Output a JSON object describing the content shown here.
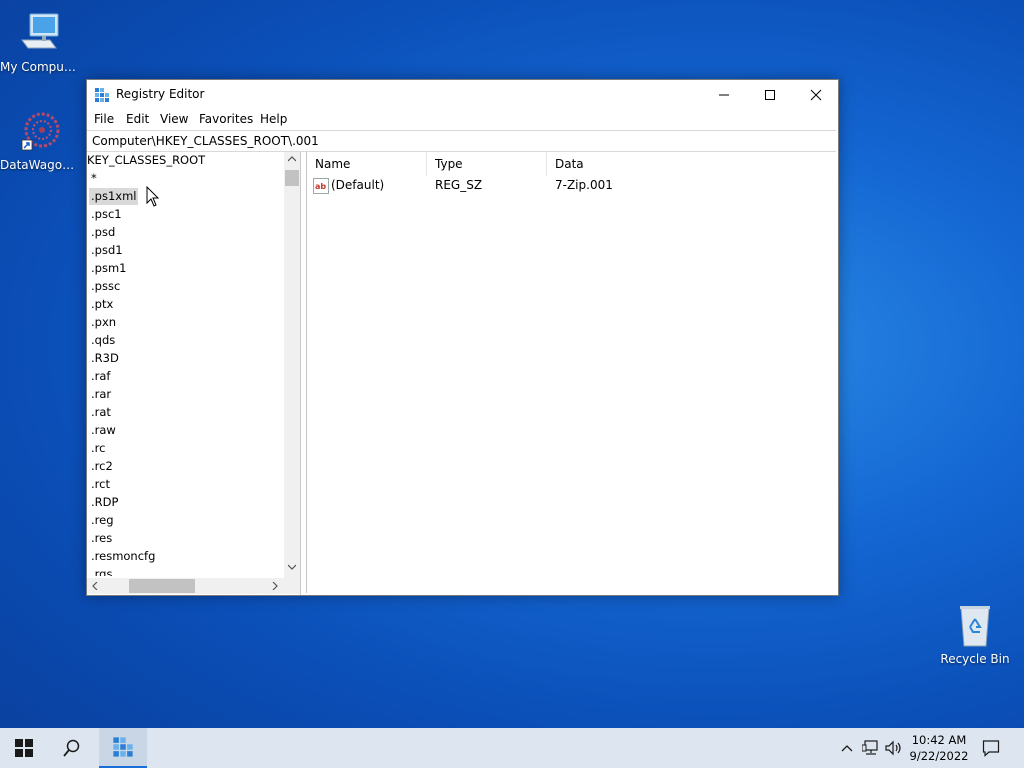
{
  "desktop": {
    "icons": [
      {
        "label": "My Computer",
        "icon": "computer-icon"
      },
      {
        "label": "DataWagon...",
        "icon": "datawagon-shortcut-icon"
      },
      {
        "label": "Recycle Bin",
        "icon": "recycle-bin-icon"
      }
    ]
  },
  "window": {
    "title": "Registry Editor",
    "icon": "registry-editor-icon",
    "menu": [
      "File",
      "Edit",
      "View",
      "Favorites",
      "Help"
    ],
    "address": "Computer\\HKEY_CLASSES_ROOT\\.001",
    "tree": {
      "header": "KEY_CLASSES_ROOT",
      "items": [
        "*",
        ".ps1xml",
        ".psc1",
        ".psd",
        ".psd1",
        ".psm1",
        ".pssc",
        ".ptx",
        ".pxn",
        ".qds",
        ".R3D",
        ".raf",
        ".rar",
        ".rat",
        ".raw",
        ".rc",
        ".rc2",
        ".rct",
        ".RDP",
        ".reg",
        ".res",
        ".resmoncfg",
        ".rgs"
      ],
      "selected": ".ps1xml"
    },
    "list": {
      "columns": [
        "Name",
        "Type",
        "Data"
      ],
      "rows": [
        {
          "name": "(Default)",
          "type": "REG_SZ",
          "data": "7-Zip.001",
          "icon": "string-value-icon"
        }
      ]
    }
  },
  "taskbar": {
    "clock_time": "10:42 AM",
    "clock_date": "9/22/2022",
    "accent": "#1a6fd6"
  }
}
